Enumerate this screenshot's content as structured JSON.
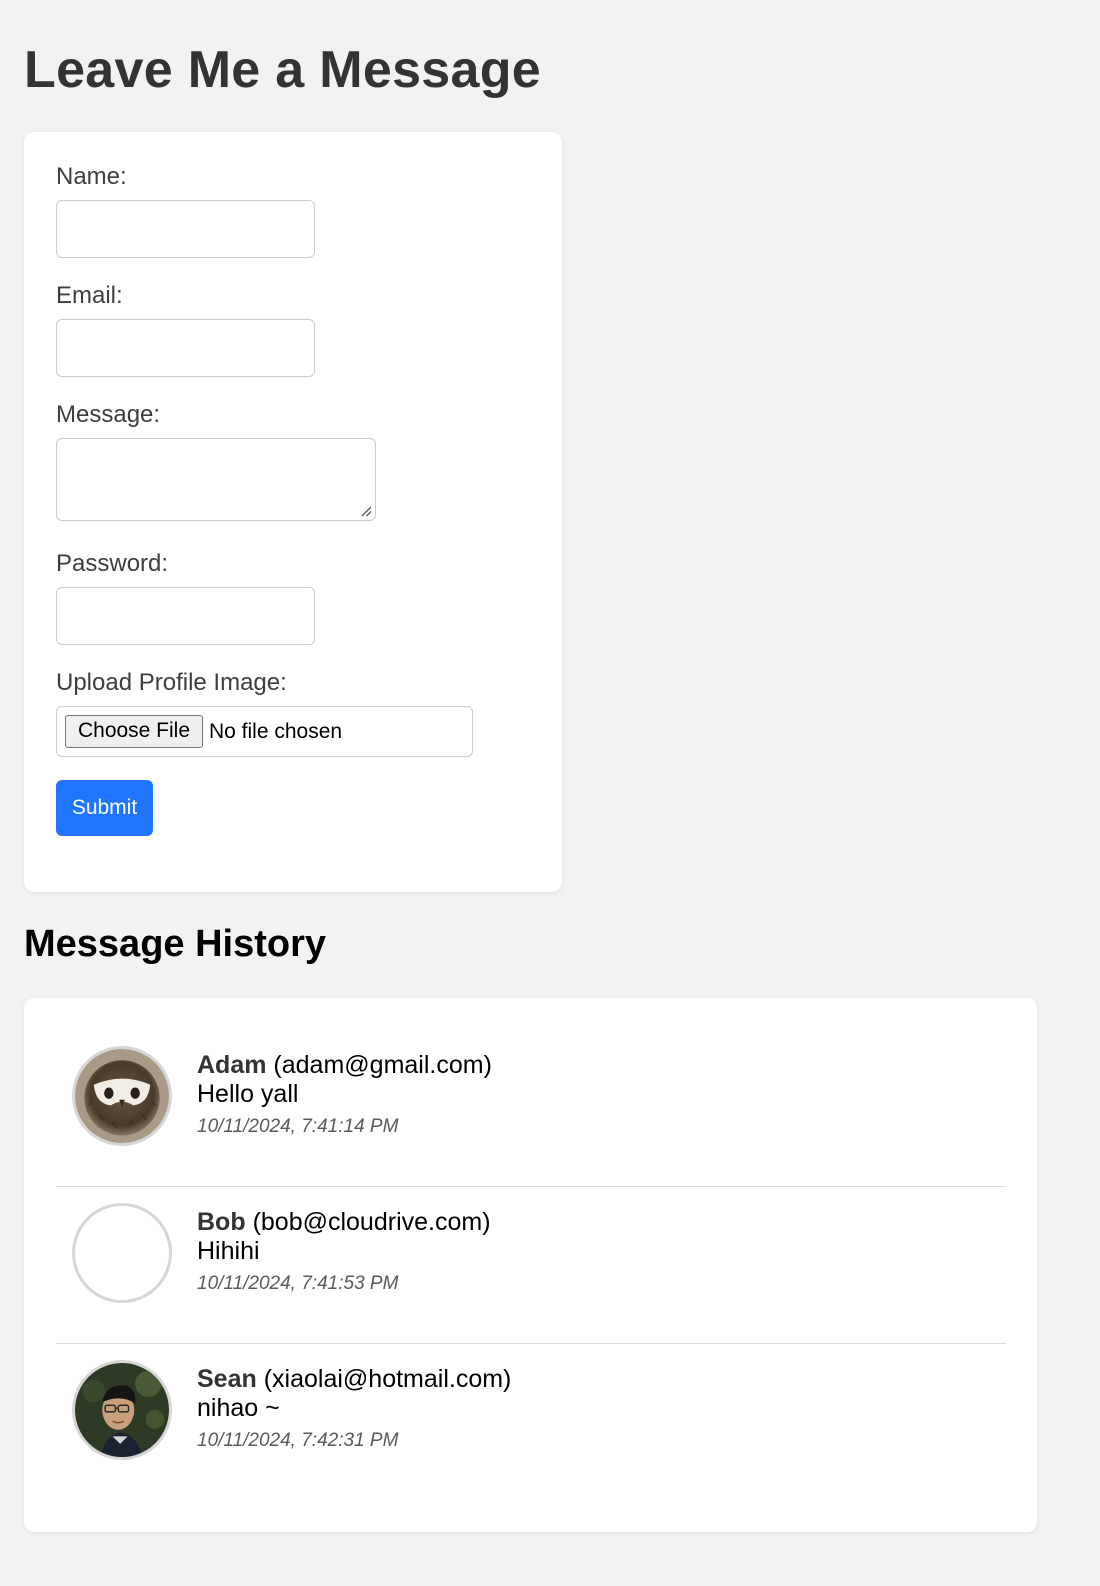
{
  "page": {
    "title": "Leave Me a Message"
  },
  "form": {
    "name_label": "Name:",
    "name_value": "",
    "email_label": "Email:",
    "email_value": "",
    "message_label": "Message:",
    "message_value": "",
    "password_label": "Password:",
    "password_value": "",
    "upload_label": "Upload Profile Image:",
    "choose_file_label": "Choose File",
    "no_file_text": "No file chosen",
    "submit_label": "Submit"
  },
  "history": {
    "title": "Message History",
    "messages": [
      {
        "name": "Adam",
        "email": "(adam@gmail.com)",
        "text": "Hello yall",
        "time": "10/11/2024, 7:41:14 PM",
        "avatar": "owl-plush-photo"
      },
      {
        "name": "Bob",
        "email": "(bob@cloudrive.com)",
        "text": "Hihihi",
        "time": "10/11/2024, 7:41:53 PM",
        "avatar": "empty"
      },
      {
        "name": "Sean",
        "email": "(xiaolai@hotmail.com)",
        "text": "nihao ~",
        "time": "10/11/2024, 7:42:31 PM",
        "avatar": "person-with-glasses-photo"
      }
    ]
  },
  "colors": {
    "page_background": "#f2f2f2",
    "card_background": "#ffffff",
    "submit_button": "#1f75fe",
    "input_border": "#cccccc",
    "divider": "#dddddd"
  }
}
